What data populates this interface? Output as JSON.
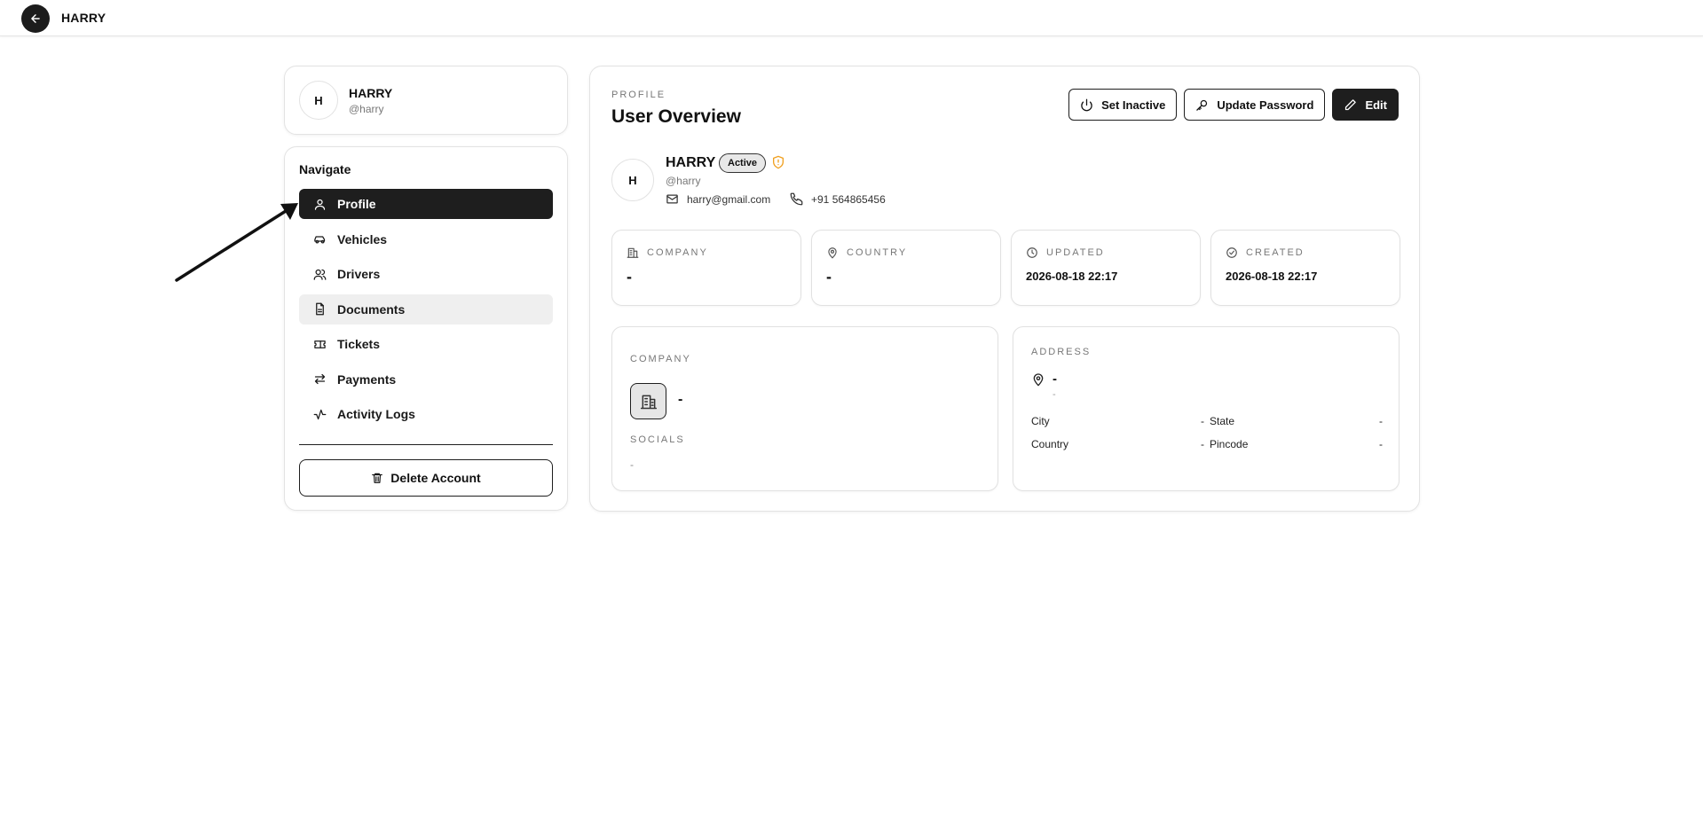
{
  "topbar": {
    "title": "HARRY"
  },
  "user_card": {
    "initial": "H",
    "name": "HARRY",
    "handle": "@harry"
  },
  "nav": {
    "title": "Navigate",
    "items": [
      {
        "label": "Profile",
        "icon": "user-icon"
      },
      {
        "label": "Vehicles",
        "icon": "car-icon"
      },
      {
        "label": "Drivers",
        "icon": "users-icon"
      },
      {
        "label": "Documents",
        "icon": "document-icon"
      },
      {
        "label": "Tickets",
        "icon": "ticket-icon"
      },
      {
        "label": "Payments",
        "icon": "arrows-swap-icon"
      },
      {
        "label": "Activity Logs",
        "icon": "activity-icon"
      }
    ],
    "active_item": "Profile",
    "hovered_item": "Documents",
    "delete_label": "Delete Account"
  },
  "main": {
    "kicker": "PROFILE",
    "title": "User Overview",
    "actions": {
      "set_inactive": "Set Inactive",
      "update_password": "Update Password",
      "edit": "Edit"
    },
    "profile": {
      "initial": "H",
      "name": "HARRY",
      "status": "Active",
      "handle": "@harry",
      "email": "harry@gmail.com",
      "phone": "+91 564865456"
    },
    "stats": [
      {
        "label": "COMPANY",
        "value": "-",
        "icon": "building-icon"
      },
      {
        "label": "COUNTRY",
        "value": "-",
        "icon": "map-pin-icon"
      },
      {
        "label": "UPDATED",
        "value": "2026-08-18 22:17",
        "icon": "clock-icon"
      },
      {
        "label": "CREATED",
        "value": "2026-08-18 22:17",
        "icon": "check-circle-icon"
      }
    ],
    "company_panel": {
      "label": "COMPANY",
      "value": "-",
      "socials_label": "SOCIALS",
      "socials_value": "-"
    },
    "address_panel": {
      "label": "ADDRESS",
      "line1": "-",
      "line2": "-",
      "fields": [
        {
          "key": "City",
          "value": "-"
        },
        {
          "key": "State",
          "value": "-"
        },
        {
          "key": "Country",
          "value": "-"
        },
        {
          "key": "Pincode",
          "value": "-"
        }
      ]
    }
  },
  "colors": {
    "primary": "#1e1e1e",
    "accent_warning": "#f0a020",
    "border": "#e3e3e3",
    "muted_text": "#777777"
  }
}
